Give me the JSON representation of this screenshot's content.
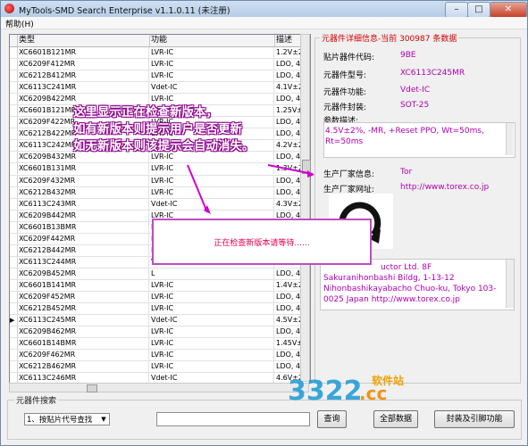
{
  "window": {
    "title": "MyTools-SMD Search Enterprise v1.1.0.11 (未注册)",
    "minimize": "–",
    "maximize": "□",
    "close": "✕"
  },
  "menu": {
    "help": "帮助(H)"
  },
  "table": {
    "columns": [
      "类型",
      "功能",
      "描述"
    ],
    "selected_row_marker": "▶",
    "rows": [
      [
        "XC6601B121MR",
        "LVR-IC",
        "1.2V±20m"
      ],
      [
        "XC6209F412MR",
        "LVR-IC",
        "LDO, 4.1V"
      ],
      [
        "XC6212B412MR",
        "LVR-IC",
        "LDO, 4.1V"
      ],
      [
        "XC6113C241MR",
        "Vdet-IC",
        "4.1V±2%"
      ],
      [
        "XC6209B422MR",
        "LVR-IC",
        "LDO, 4.2V"
      ],
      [
        "XC6601B121MR",
        "LVR-IC",
        "1.25V±20"
      ],
      [
        "XC6209F422MR",
        "LVR-IC",
        "LDO, 4.2V"
      ],
      [
        "XC6212B422MR",
        "LVR-IC",
        "LDO, 4.2V"
      ],
      [
        "XC6113C242MR",
        "Vdet-IC",
        "4.2V±2%"
      ],
      [
        "XC6209B432MR",
        "LVR-IC",
        "LDO, 4.3V"
      ],
      [
        "XC6601B131MR",
        "LVR-IC",
        "1.3V±20m"
      ],
      [
        "XC6209F432MR",
        "LVR-IC",
        "LDO, 4.3V"
      ],
      [
        "XC6212B432MR",
        "LVR-IC",
        "LDO, 4.3V"
      ],
      [
        "XC6113C243MR",
        "Vdet-IC",
        "4.3V±2%"
      ],
      [
        "XC6209B442MR",
        "LVR-IC",
        "LDO, 4.4V"
      ],
      [
        "XC6601B13BMR",
        "LVR-IC",
        "1.35V±20"
      ],
      [
        "XC6209F442MR",
        "L",
        "LDO, 4.4V"
      ],
      [
        "XC6212B442MR",
        "L",
        "LDO, 4.4V"
      ],
      [
        "XC6113C244MR",
        "V",
        "4.4V±2%"
      ],
      [
        "XC6209B452MR",
        "L",
        "LDO, 4.5V"
      ],
      [
        "XC6601B141MR",
        "LVR-IC",
        "1.4V±20m"
      ],
      [
        "XC6209F452MR",
        "LVR-IC",
        "LDO, 4.5V"
      ],
      [
        "XC6212B452MR",
        "LVR-IC",
        "LDO, 4.5V"
      ],
      [
        "XC6113C245MR",
        "Vdet-IC",
        "4.5V±2%"
      ],
      [
        "XC6209B462MR",
        "LVR-IC",
        "LDO, 4.6V"
      ],
      [
        "XC6601B14BMR",
        "LVR-IC",
        "1.45V±20"
      ],
      [
        "XC6209F462MR",
        "LVR-IC",
        "LDO, 4.6V"
      ],
      [
        "XC6212B462MR",
        "LVR-IC",
        "LDO, 4.6V"
      ],
      [
        "XC6113C246MR",
        "Vdet-IC",
        "4.6V±2%"
      ]
    ],
    "selected_index": 23
  },
  "detail": {
    "legend": "元器件详细信息-当前 300987 条数据",
    "fields": [
      {
        "label": "贴片器件代码:",
        "value": "9BE"
      },
      {
        "label": "元器件型号:",
        "value": "XC6113C245MR"
      },
      {
        "label": "元器件功能:",
        "value": "Vdet-IC"
      },
      {
        "label": "元器件封装:",
        "value": "SOT-25"
      }
    ],
    "params_label": "参数描述:",
    "params_value": "4.5V±2%, -MR, +Reset PPO, Wt=50ms, Rt=50ms",
    "maker_label": "生产厂家信息:",
    "maker_value": "Tor",
    "site_label": "生产厂家网址:",
    "site_value": "http://www.torex.co.jp",
    "address_lines": [
      "uctor Ltd. 8F",
      "Sakuranihonbashi Bildg, 1-13-12",
      "Nihonbashikayabacho Chuo-ku, Tokyo 103-",
      "0025 Japan http://www.torex.co.jp"
    ]
  },
  "annotation": {
    "lines": [
      "这里显示正在检查新版本，",
      "如有新版本则提示用户是否更新",
      "如无新版本则该提示会自动消失。"
    ],
    "color": "#8a008a"
  },
  "dialog": {
    "text": "正在检查新版本请等待......"
  },
  "search": {
    "legend": "元器件搜索",
    "mode_selected": "1、按贴片代号查找",
    "input_value": "",
    "query_button": "查询",
    "all_button": "全部数据",
    "package_button": "封装及引脚功能"
  },
  "watermark": {
    "text": "软件站",
    "brand": "3322.cc"
  }
}
